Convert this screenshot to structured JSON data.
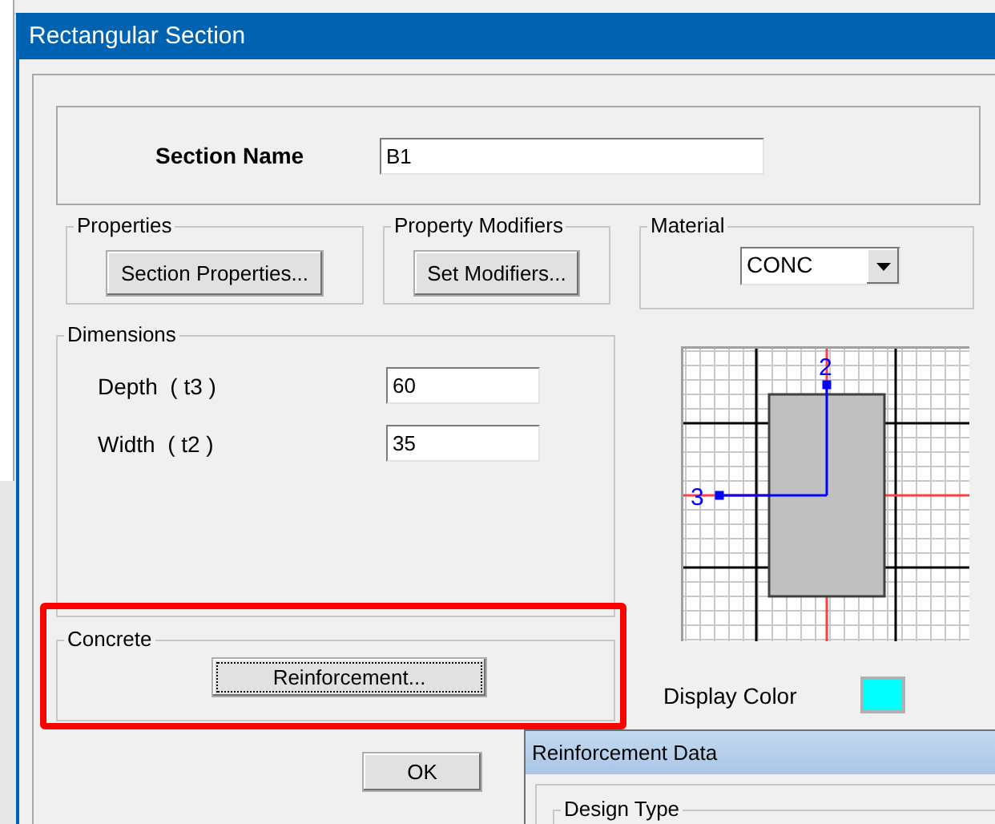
{
  "window": {
    "title": "Rectangular Section"
  },
  "section_name": {
    "label": "Section Name",
    "value": "B1"
  },
  "properties": {
    "title": "Properties",
    "button": "Section Properties..."
  },
  "property_modifiers": {
    "title": "Property Modifiers",
    "button": "Set Modifiers..."
  },
  "material": {
    "title": "Material",
    "value": "CONC"
  },
  "dimensions": {
    "title": "Dimensions",
    "fields": [
      {
        "label": "Depth  ( t3 )",
        "value": "60"
      },
      {
        "label": "Width  ( t2 )",
        "value": "35"
      }
    ]
  },
  "concrete": {
    "title": "Concrete",
    "button": "Reinforcement...",
    "focused": true,
    "highlighted": true
  },
  "preview": {
    "axis_labels": [
      "2",
      "3"
    ]
  },
  "display_color": {
    "label": "Display Color",
    "color": "#00ffff"
  },
  "ok_button": "OK",
  "reinforcement_window": {
    "title": "Reinforcement Data",
    "group": "Design Type"
  }
}
